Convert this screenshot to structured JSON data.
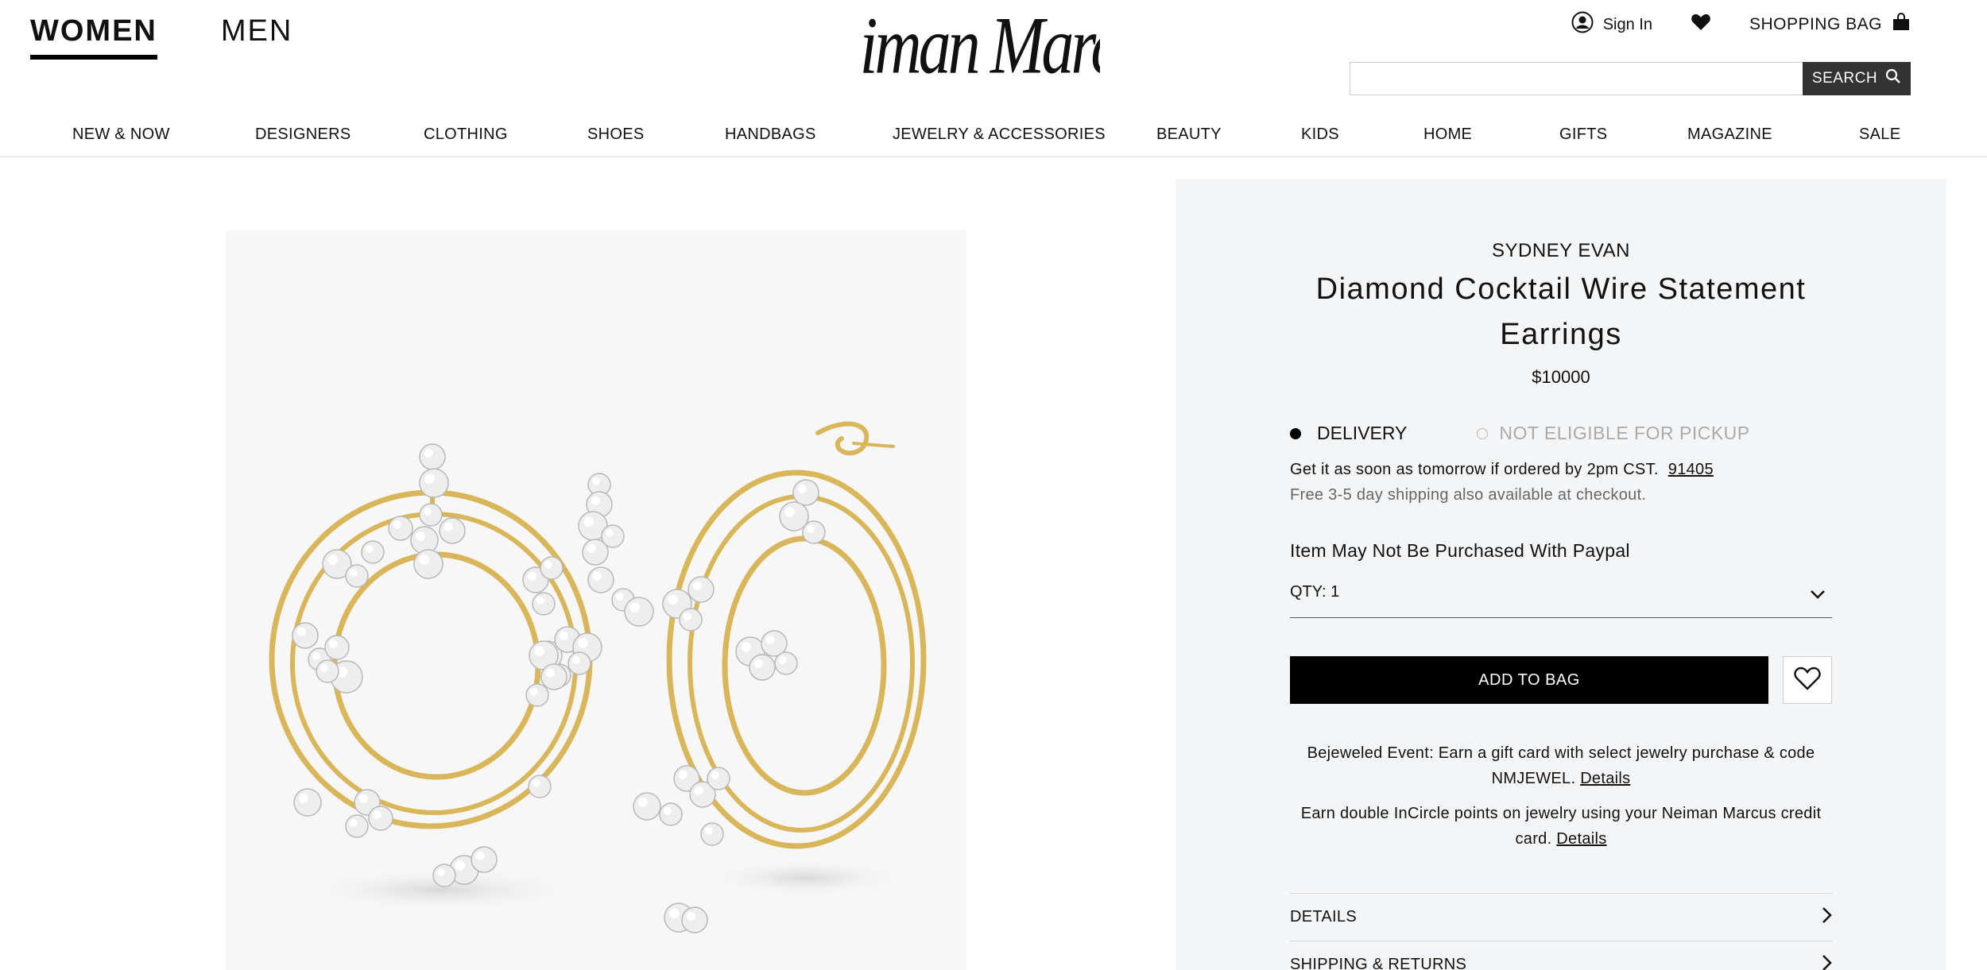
{
  "header": {
    "gender_tabs": [
      {
        "label": "WOMEN",
        "active": true
      },
      {
        "label": "MEN",
        "active": false
      }
    ],
    "logo_text": "Neiman Marcus",
    "utility": {
      "sign_in": "Sign In",
      "shopping_bag": "SHOPPING BAG"
    },
    "search": {
      "placeholder": "",
      "button": "SEARCH"
    }
  },
  "nav": {
    "items": [
      "NEW & NOW",
      "DESIGNERS",
      "CLOTHING",
      "SHOES",
      "HANDBAGS",
      "JEWELRY & ACCESSORIES",
      "BEAUTY",
      "KIDS",
      "HOME",
      "GIFTS",
      "MAGAZINE",
      "SALE"
    ]
  },
  "product": {
    "designer": "SYDNEY EVAN",
    "title": "Diamond Cocktail Wire Statement Earrings",
    "price": "$10000",
    "delivery_label": "DELIVERY",
    "pickup_label": "NOT ELIGIBLE FOR PICKUP",
    "ship_line1": "Get it as soon as tomorrow if ordered by 2pm CST.",
    "zip": "91405",
    "ship_line2": "Free 3-5 day shipping also available at checkout.",
    "paypal_notice": "Item May Not Be Purchased With Paypal",
    "qty_label": "QTY: 1",
    "add_to_bag": "ADD TO BAG",
    "promo1_text": "Bejeweled Event: Earn a gift card with select jewelry purchase & code NMJEWEL.",
    "promo1_link": "Details",
    "promo2_text": "Earn double InCircle points on jewelry using your Neiman Marcus credit card.",
    "promo2_link": "Details",
    "accordions": [
      "DETAILS",
      "SHIPPING & RETURNS"
    ]
  },
  "colors": {
    "panel_bg": "#f4f5f6",
    "gold": "#d9b65a",
    "button_black": "#000000"
  },
  "icons": [
    "user-icon",
    "heart-icon",
    "shopping-bag-icon",
    "search-icon",
    "chevron-down-icon",
    "chevron-right-icon"
  ]
}
